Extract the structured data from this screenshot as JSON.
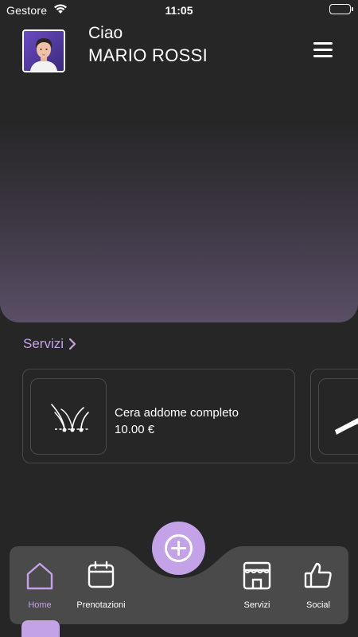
{
  "status_bar": {
    "carrier": "Gestore",
    "time": "11:05"
  },
  "header": {
    "greeting": "Ciao",
    "user_name": "MARIO ROSSI"
  },
  "services_section": {
    "title": "Servizi",
    "cards": [
      {
        "name": "Cera addome completo",
        "price": "10.00 €",
        "icon": "hair-wax-icon"
      },
      {
        "name": "",
        "price": "",
        "icon": "swoosh-icon"
      }
    ]
  },
  "nav": {
    "items": [
      {
        "label": "Home",
        "icon": "home-icon",
        "active": true
      },
      {
        "label": "Prenotazioni",
        "icon": "calendar-icon",
        "active": false
      },
      {
        "label": "Servizi",
        "icon": "storefront-icon",
        "active": false
      },
      {
        "label": "Social",
        "icon": "thumbs-up-icon",
        "active": false
      }
    ],
    "fab_icon": "plus-circle-icon"
  },
  "colors": {
    "accent": "#c4a2e8",
    "background": "#262626",
    "navbar": "#4a4a4a",
    "hero_gradient_bottom": "#5a4f66"
  }
}
